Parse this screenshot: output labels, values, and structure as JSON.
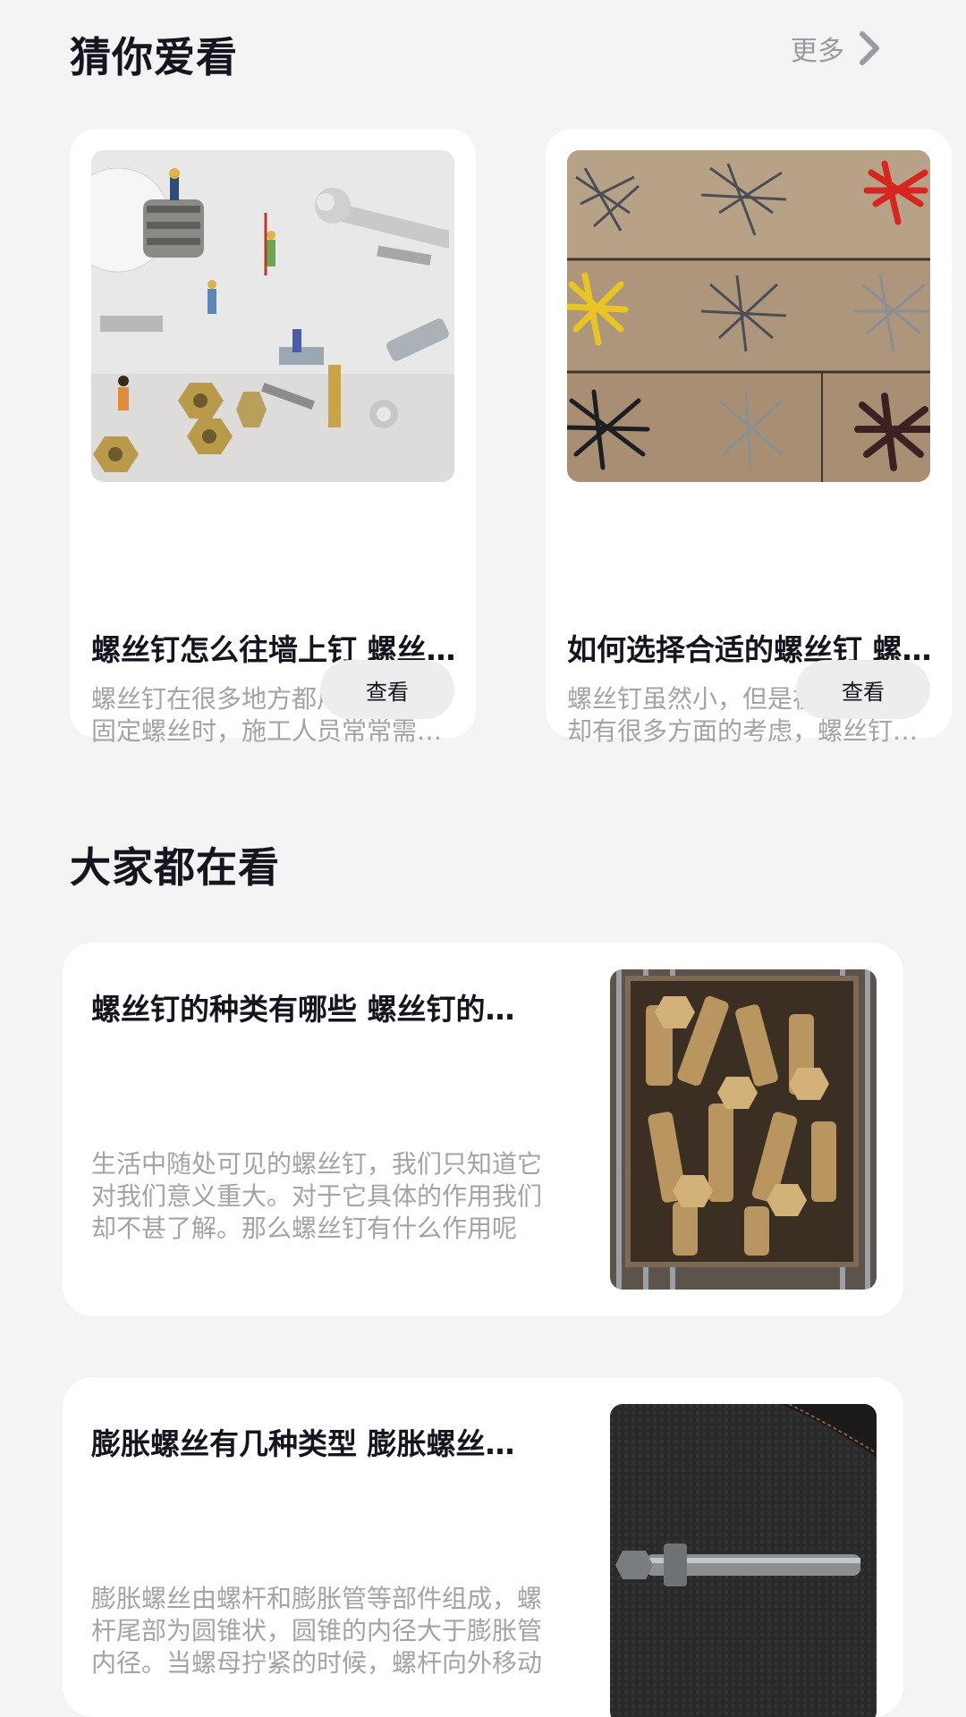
{
  "guess": {
    "title": "猜你爱看",
    "more_label": "更多",
    "cards": [
      {
        "title": "螺丝钉怎么往墙上钉 螺丝钉往墙上钉的方法",
        "desc": "螺丝钉在很多地方都用得到，在固定螺丝时，施工人员常常需要将螺丝钉钉在墙上",
        "button": "查看",
        "image": "miniature-workers-with-screws-photo"
      },
      {
        "title": "如何选择合适的螺丝钉 螺丝钉的选购方法",
        "desc": "螺丝钉虽然小，但是在选用方面却有很多方面的考虑，螺丝钉的选择非常重要",
        "button": "查看",
        "image": "assorted-nails-and-anchors-on-wood-photo"
      }
    ]
  },
  "popular": {
    "title": "大家都在看",
    "cards": [
      {
        "title": "螺丝钉的种类有哪些 螺丝钉的作用是什么",
        "desc": "生活中随处可见的螺丝钉，我们只知道它对我们意义重大。对于它具体的作用我们却不甚了解。那么螺丝钉有什么作用呢",
        "image": "brass-bolts-in-box-photo"
      },
      {
        "title": "膨胀螺丝有几种类型 膨胀螺丝的安装方法",
        "desc": "膨胀螺丝由螺杆和膨胀管等部件组成，螺杆尾部为圆锥状，圆锥的内径大于膨胀管内径。当螺母拧紧的时候，螺杆向外移动",
        "image": "expansion-bolt-on-dark-fabric-photo"
      }
    ]
  },
  "colors": {
    "background": "#f4f4f5",
    "card": "#ffffff",
    "title_text": "#14151f",
    "muted_text": "#a3a3a8",
    "button_bg": "#ededed"
  }
}
